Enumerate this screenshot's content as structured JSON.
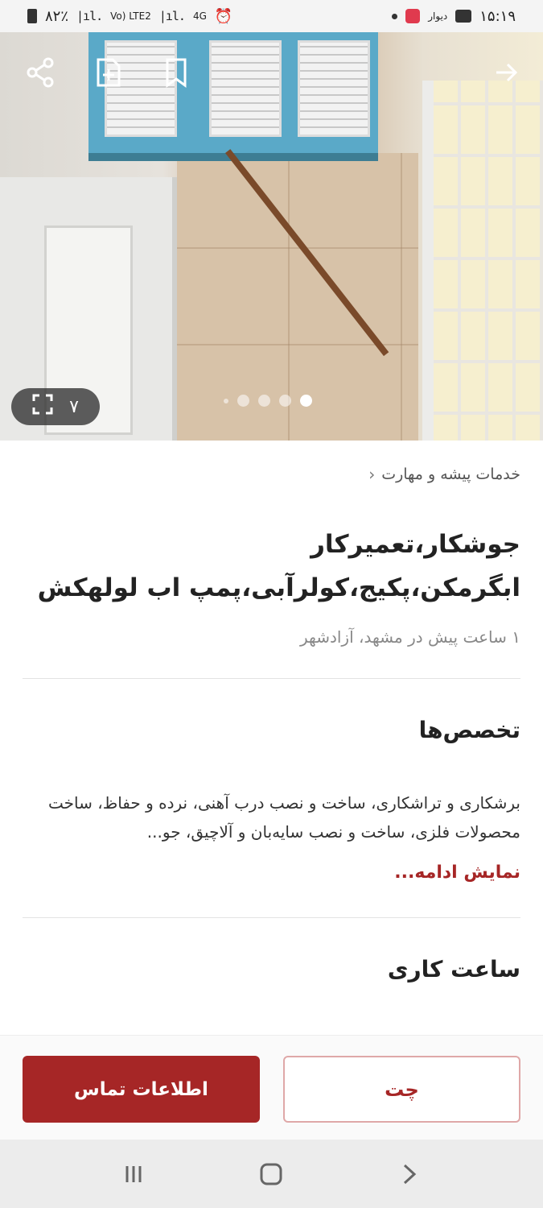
{
  "status_bar": {
    "time": "۱۵:۱۹",
    "battery": "۸۲٪",
    "network_1": "Vo) LTE2",
    "network_2": "4G",
    "app_label": "دیوار"
  },
  "hero": {
    "photo_count": "۷",
    "dot_count": 5,
    "active_dot": 0
  },
  "breadcrumb": "خدمات پیشه و مهارت",
  "ad": {
    "title": "جوشکار،تعمیرکار ابگرمکن،پکیج،کولرآبی،پمپ اب لولهکش",
    "meta": "۱ ساعت پیش در مشهد، آزادشهر"
  },
  "specialties": {
    "heading": "تخصص‌ها",
    "description": "برشکاری و تراشکاری، ساخت و نصب درب آهنی، نرده و حفاظ، ساخت محصولات فلزی، ساخت و نصب سایه‌بان و آلاچیق، جو...",
    "show_more": "نمایش ادامه..."
  },
  "working_hours": {
    "heading": "ساعت کاری"
  },
  "actions": {
    "contact_label": "اطلاعات تماس",
    "chat_label": "چت"
  },
  "colors": {
    "brand": "#a62626",
    "brand_border": "#dfa8a8"
  }
}
